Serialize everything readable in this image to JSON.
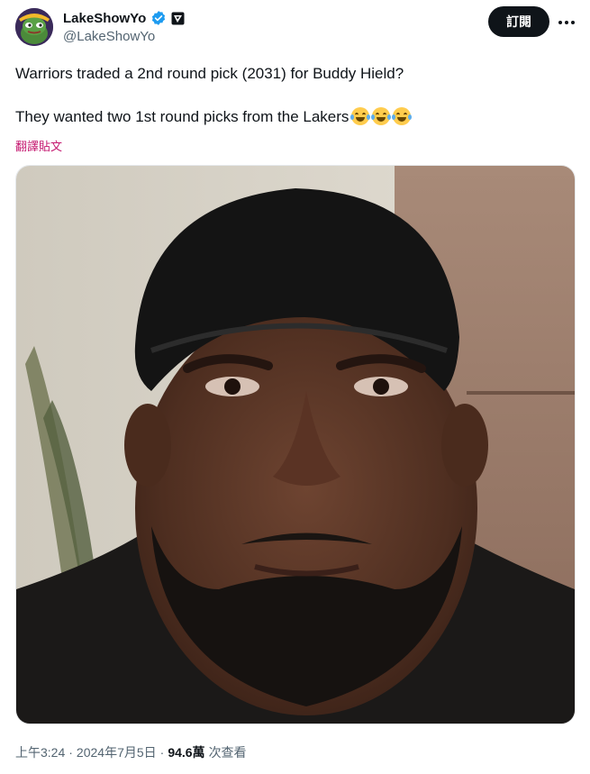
{
  "author": {
    "display_name": "LakeShowYo",
    "handle": "@LakeShowYo"
  },
  "header": {
    "subscribe_label": "訂閱"
  },
  "tweet": {
    "line1": "Warriors traded a 2nd round pick (2031) for Buddy Hield?",
    "line2": "They wanted two 1st round picks from the Lakers",
    "emojis": [
      "face-with-tears-of-joy",
      "face-with-tears-of-joy",
      "face-with-tears-of-joy"
    ],
    "translate_label": "翻譯貼文"
  },
  "footer": {
    "time": "上午3:24",
    "sep1": "·",
    "date": "2024年7月5日",
    "sep2": "·",
    "views_count": "94.6萬",
    "views_label": "次查看"
  },
  "colors": {
    "accent": "#1d9bf0",
    "translate": "#c4166f",
    "button_bg": "#0f1419"
  }
}
